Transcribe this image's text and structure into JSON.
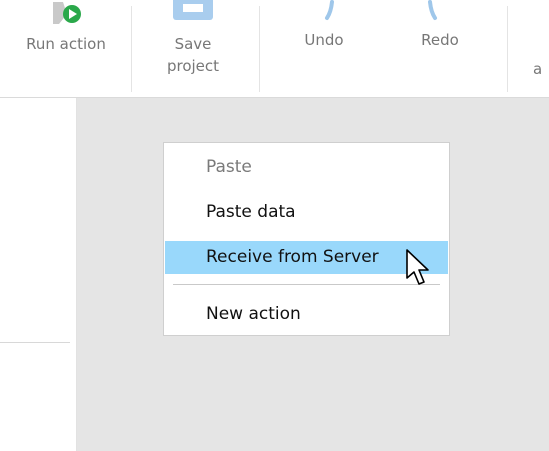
{
  "toolbar": {
    "run_action_label": "Run action",
    "save_project_label": "Save project",
    "undo_label": "Undo",
    "redo_label": "Redo",
    "partial_label": "a",
    "icons": [
      "run-icon",
      "save-icon",
      "undo-icon",
      "redo-icon"
    ]
  },
  "context_menu": {
    "items": [
      {
        "label": "Paste",
        "enabled": false
      },
      {
        "label": "Paste data",
        "enabled": true
      },
      {
        "label": "Receive from Server",
        "enabled": true,
        "highlighted": true
      },
      {
        "label": "New action",
        "enabled": true
      }
    ]
  },
  "colors": {
    "highlight": "#99d8fb",
    "canvas": "#e5e5e5",
    "icon_blue": "#9fc7ea",
    "icon_green": "#2aa84a"
  }
}
